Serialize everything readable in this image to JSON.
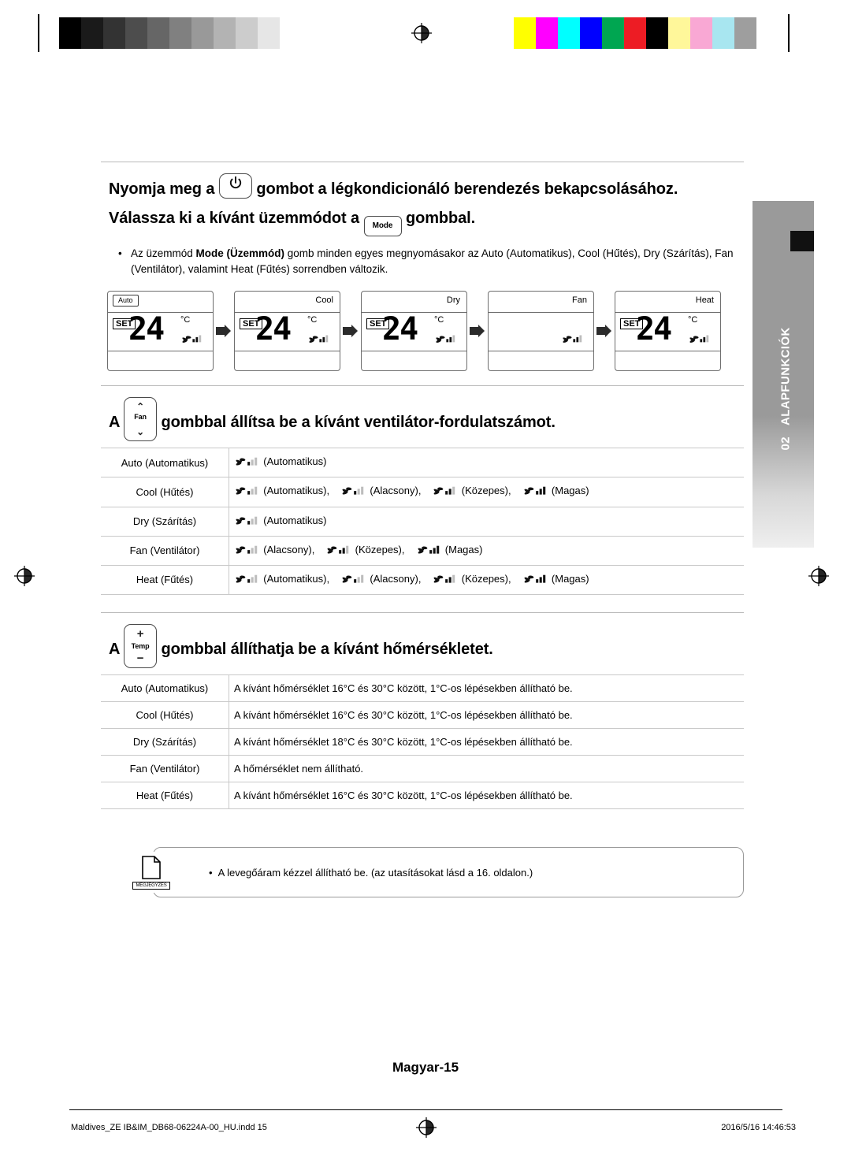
{
  "headings": {
    "power_before": "Nyomja meg a",
    "power_after": "gombot a légkondicionáló berendezés bekapcsolásához.",
    "mode_before": "Válassza ki a kívánt üzemmódot a",
    "mode_after": "gombbal.",
    "fan_before": "A",
    "fan_after": "gombbal állítsa be a kívánt ventilátor-fordulatszámot.",
    "temp_before": "A",
    "temp_after": "gombbal állíthatja be a kívánt hőmérsékletet."
  },
  "bullet": {
    "dot": "•",
    "text_1": "Az üzemmód ",
    "bold": "Mode (Üzemmód)",
    "text_2": " gomb minden egyes megnyomásakor az Auto (Automatikus), Cool (Hűtés), Dry (Szárítás), Fan (Ventilátor), valamint Heat (Fűtés) sorrendben változik."
  },
  "keys": {
    "mode_label": "Mode",
    "fan_label": "Fan",
    "temp_label": "Temp",
    "plus": "+",
    "minus": "−",
    "up": "⌃",
    "down": "⌄"
  },
  "displays": [
    {
      "mode": "Auto",
      "mode_pos": "box",
      "set": "SET",
      "value": "24",
      "deg": "°C",
      "show_value": true
    },
    {
      "mode": "Cool",
      "mode_pos": "right",
      "set": "SET",
      "value": "24",
      "deg": "°C",
      "show_value": true
    },
    {
      "mode": "Dry",
      "mode_pos": "right",
      "set": "SET",
      "value": "24",
      "deg": "°C",
      "show_value": true
    },
    {
      "mode": "Fan",
      "mode_pos": "right",
      "set": "",
      "value": "",
      "deg": "",
      "show_value": false
    },
    {
      "mode": "Heat",
      "mode_pos": "right",
      "set": "SET",
      "value": "24",
      "deg": "°C",
      "show_value": true
    }
  ],
  "fan_table": {
    "rows": [
      {
        "mode": "Auto (Automatikus)",
        "items": [
          {
            "icon": "fan-auto",
            "label": "(Automatikus)"
          }
        ]
      },
      {
        "mode": "Cool (Hűtés)",
        "items": [
          {
            "icon": "fan-auto",
            "label": "(Automatikus),"
          },
          {
            "icon": "fan-low",
            "label": "(Alacsony),"
          },
          {
            "icon": "fan-med",
            "label": "(Közepes),"
          },
          {
            "icon": "fan-high",
            "label": "(Magas)"
          }
        ]
      },
      {
        "mode": "Dry (Szárítás)",
        "items": [
          {
            "icon": "fan-auto",
            "label": "(Automatikus)"
          }
        ]
      },
      {
        "mode": "Fan (Ventilátor)",
        "items": [
          {
            "icon": "fan-low",
            "label": "(Alacsony),"
          },
          {
            "icon": "fan-med",
            "label": "(Közepes),"
          },
          {
            "icon": "fan-high",
            "label": "(Magas)"
          }
        ]
      },
      {
        "mode": "Heat (Fűtés)",
        "items": [
          {
            "icon": "fan-auto",
            "label": "(Automatikus),"
          },
          {
            "icon": "fan-low",
            "label": "(Alacsony),"
          },
          {
            "icon": "fan-med",
            "label": "(Közepes),"
          },
          {
            "icon": "fan-high",
            "label": "(Magas)"
          }
        ]
      }
    ]
  },
  "temp_table": {
    "rows": [
      {
        "mode": "Auto (Automatikus)",
        "text": "A kívánt hőmérséklet 16°C és 30°C között, 1°C-os lépésekben állítható be."
      },
      {
        "mode": "Cool (Hűtés)",
        "text": "A kívánt hőmérséklet 16°C és 30°C között, 1°C-os lépésekben állítható be."
      },
      {
        "mode": "Dry (Szárítás)",
        "text": "A kívánt hőmérséklet 18°C és 30°C között, 1°C-os lépésekben állítható be."
      },
      {
        "mode": "Fan (Ventilátor)",
        "text": "A hőmérséklet nem állítható."
      },
      {
        "mode": "Heat (Fűtés)",
        "text": "A kívánt hőmérséklet 16°C és 30°C között, 1°C-os lépésekben állítható be."
      }
    ]
  },
  "note": {
    "icon_label": "MEGJEGYZÉS",
    "dot": "•",
    "text": "A levegőáram kézzel állítható be. (az utasításokat lásd a 16. oldalon.)"
  },
  "sidetab": {
    "number": "02",
    "label": "ALAPFUNKCIÓK"
  },
  "footer": {
    "page_number": "Magyar-15",
    "file": "Maldives_ZE IB&IM_DB68-06224A-00_HU.indd   15",
    "timestamp": "2016/5/16   14:46:53"
  },
  "calibration": {
    "gray_swatches": [
      "#000000",
      "#1a1a1a",
      "#333333",
      "#4d4d4d",
      "#666666",
      "#808080",
      "#999999",
      "#b3b3b3",
      "#cccccc",
      "#e6e6e6",
      "#ffffff"
    ],
    "color_swatches": [
      "#ffff00",
      "#ff00ff",
      "#00ffff",
      "#0000ff",
      "#00a651",
      "#ed1c24",
      "#000000",
      "#fff79a",
      "#f9a8d4",
      "#a8e6f0",
      "#9e9e9e"
    ]
  }
}
